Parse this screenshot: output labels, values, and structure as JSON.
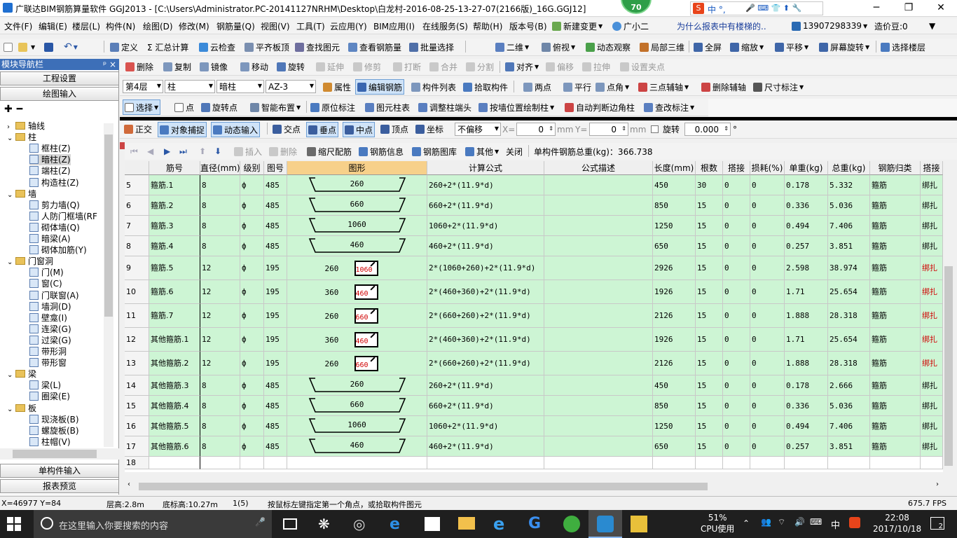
{
  "window": {
    "title": "广联达BIM钢筋算量软件 GGJ2013 - [C:\\Users\\Administrator.PC-20141127NRHM\\Desktop\\白龙村-2016-08-25-13-27-07(2166版)_16G.GGJ12]",
    "badge": "70",
    "ime": "中 °,"
  },
  "menu": {
    "items": [
      "文件(F)",
      "编辑(E)",
      "楼层(L)",
      "构件(N)",
      "绘图(D)",
      "修改(M)",
      "钢筋量(Q)",
      "视图(V)",
      "工具(T)",
      "云应用(Y)",
      "BIM应用(I)",
      "在线服务(S)",
      "帮助(H)",
      "版本号(B)",
      "新建变更",
      "广小二"
    ],
    "question": "为什么报表中有楼梯的..",
    "phone": "13907298339",
    "price": "造价豆:0"
  },
  "toolbar1": [
    "定义",
    "Σ 汇总计算",
    "云检查",
    "平齐板顶",
    "查找图元",
    "查看钢筋量",
    "批量选择",
    "二维",
    "俯视",
    "动态观察",
    "局部三维",
    "全屏",
    "缩放",
    "平移",
    "屏幕旋转",
    "选择楼层"
  ],
  "toolbar2": [
    "删除",
    "复制",
    "镜像",
    "移动",
    "旋转",
    "延伸",
    "修剪",
    "打断",
    "合并",
    "分割",
    "对齐",
    "偏移",
    "拉伸",
    "设置夹点"
  ],
  "toolbar3": {
    "floor": "第4层",
    "type": "柱",
    "subtype": "暗柱",
    "name": "AZ-3",
    "items": [
      "属性",
      "编辑钢筋",
      "构件列表",
      "拾取构件",
      "两点",
      "平行",
      "点角",
      "三点辅轴",
      "删除辅轴",
      "尺寸标注"
    ]
  },
  "toolbar4": [
    "选择",
    "点",
    "旋转点",
    "智能布置",
    "原位标注",
    "图元柱表",
    "调整柱端头",
    "按墙位置绘制柱",
    "自动判断边角柱",
    "查改标注"
  ],
  "snapbar": {
    "items": [
      "正交",
      "对象捕捉",
      "动态输入",
      "交点",
      "垂点",
      "中点",
      "顶点",
      "坐标"
    ],
    "offset": "不偏移",
    "x_label": "X=",
    "x_val": "0",
    "y_label": "Y=",
    "y_val": "0",
    "unit": "mm",
    "rotate": "旋转",
    "rotate_val": "0.000",
    "deg": "°"
  },
  "rebarbar": {
    "items": [
      "插入",
      "删除",
      "缩尺配筋",
      "钢筋信息",
      "钢筋图库",
      "其他",
      "关闭"
    ],
    "total": "单构件钢筋总重(kg)：366.738"
  },
  "panel": {
    "title": "模块导航栏",
    "pin": "ᵖ ×",
    "btn_project": "工程设置",
    "btn_draw": "绘图输入",
    "btn_single": "单构件输入",
    "btn_report": "报表预览"
  },
  "tree": [
    {
      "t": "轴线",
      "lvl": 0,
      "kind": "folder",
      "exp": "›"
    },
    {
      "t": "柱",
      "lvl": 0,
      "kind": "folder",
      "exp": "⌄"
    },
    {
      "t": "框柱(Z)",
      "lvl": 1,
      "kind": "leaf"
    },
    {
      "t": "暗柱(Z)",
      "lvl": 1,
      "kind": "leaf",
      "sel": true
    },
    {
      "t": "端柱(Z)",
      "lvl": 1,
      "kind": "leaf"
    },
    {
      "t": "构造柱(Z)",
      "lvl": 1,
      "kind": "leaf"
    },
    {
      "t": "墙",
      "lvl": 0,
      "kind": "folder",
      "exp": "⌄"
    },
    {
      "t": "剪力墙(Q)",
      "lvl": 1,
      "kind": "leaf"
    },
    {
      "t": "人防门框墙(RF",
      "lvl": 1,
      "kind": "leaf"
    },
    {
      "t": "砌体墙(Q)",
      "lvl": 1,
      "kind": "leaf"
    },
    {
      "t": "暗梁(A)",
      "lvl": 1,
      "kind": "leaf"
    },
    {
      "t": "砌体加筋(Y)",
      "lvl": 1,
      "kind": "leaf"
    },
    {
      "t": "门窗洞",
      "lvl": 0,
      "kind": "folder",
      "exp": "⌄"
    },
    {
      "t": "门(M)",
      "lvl": 1,
      "kind": "leaf"
    },
    {
      "t": "窗(C)",
      "lvl": 1,
      "kind": "leaf"
    },
    {
      "t": "门联窗(A)",
      "lvl": 1,
      "kind": "leaf"
    },
    {
      "t": "墙洞(D)",
      "lvl": 1,
      "kind": "leaf"
    },
    {
      "t": "壁龛(I)",
      "lvl": 1,
      "kind": "leaf"
    },
    {
      "t": "连梁(G)",
      "lvl": 1,
      "kind": "leaf"
    },
    {
      "t": "过梁(G)",
      "lvl": 1,
      "kind": "leaf"
    },
    {
      "t": "带形洞",
      "lvl": 1,
      "kind": "leaf"
    },
    {
      "t": "带形窗",
      "lvl": 1,
      "kind": "leaf"
    },
    {
      "t": "梁",
      "lvl": 0,
      "kind": "folder",
      "exp": "⌄"
    },
    {
      "t": "梁(L)",
      "lvl": 1,
      "kind": "leaf"
    },
    {
      "t": "圈梁(E)",
      "lvl": 1,
      "kind": "leaf"
    },
    {
      "t": "板",
      "lvl": 0,
      "kind": "folder",
      "exp": "⌄"
    },
    {
      "t": "现浇板(B)",
      "lvl": 1,
      "kind": "leaf"
    },
    {
      "t": "螺旋板(B)",
      "lvl": 1,
      "kind": "leaf"
    },
    {
      "t": "柱帽(V)",
      "lvl": 1,
      "kind": "leaf"
    }
  ],
  "table": {
    "headers": [
      "",
      "筋号",
      "直径(mm)",
      "级别",
      "图号",
      "图形",
      "计算公式",
      "公式描述",
      "长度(mm)",
      "根数",
      "搭接",
      "损耗(%)",
      "单重(kg)",
      "总重(kg)",
      "钢筋归类",
      "搭接"
    ],
    "rows": [
      {
        "n": "5",
        "name": "箍筋.1",
        "dia": "8",
        "grade": "ф",
        "fig": "485",
        "shape": "hook",
        "s1": "260",
        "s2": "",
        "formula": "260+2*(11.9*d)",
        "desc": "",
        "len": "450",
        "cnt": "30",
        "lap": "0",
        "loss": "0",
        "uw": "0.178",
        "tw": "5.332",
        "cat": "箍筋",
        "lapt": "绑扎",
        "red": false
      },
      {
        "n": "6",
        "name": "箍筋.2",
        "dia": "8",
        "grade": "ф",
        "fig": "485",
        "shape": "hook",
        "s1": "660",
        "s2": "",
        "formula": "660+2*(11.9*d)",
        "desc": "",
        "len": "850",
        "cnt": "15",
        "lap": "0",
        "loss": "0",
        "uw": "0.336",
        "tw": "5.036",
        "cat": "箍筋",
        "lapt": "绑扎",
        "red": false
      },
      {
        "n": "7",
        "name": "箍筋.3",
        "dia": "8",
        "grade": "ф",
        "fig": "485",
        "shape": "hook",
        "s1": "1060",
        "s2": "",
        "formula": "1060+2*(11.9*d)",
        "desc": "",
        "len": "1250",
        "cnt": "15",
        "lap": "0",
        "loss": "0",
        "uw": "0.494",
        "tw": "7.406",
        "cat": "箍筋",
        "lapt": "绑扎",
        "red": false
      },
      {
        "n": "8",
        "name": "箍筋.4",
        "dia": "8",
        "grade": "ф",
        "fig": "485",
        "shape": "hook",
        "s1": "460",
        "s2": "",
        "formula": "460+2*(11.9*d)",
        "desc": "",
        "len": "650",
        "cnt": "15",
        "lap": "0",
        "loss": "0",
        "uw": "0.257",
        "tw": "3.851",
        "cat": "箍筋",
        "lapt": "绑扎",
        "red": false
      },
      {
        "n": "9",
        "name": "箍筋.5",
        "dia": "12",
        "grade": "ф",
        "fig": "195",
        "shape": "box",
        "s1": "260",
        "s2": "1060",
        "formula": "2*(1060+260)+2*(11.9*d)",
        "desc": "",
        "len": "2926",
        "cnt": "15",
        "lap": "0",
        "loss": "0",
        "uw": "2.598",
        "tw": "38.974",
        "cat": "箍筋",
        "lapt": "绑扎",
        "red": true
      },
      {
        "n": "10",
        "name": "箍筋.6",
        "dia": "12",
        "grade": "ф",
        "fig": "195",
        "shape": "box",
        "s1": "360",
        "s2": "460",
        "formula": "2*(460+360)+2*(11.9*d)",
        "desc": "",
        "len": "1926",
        "cnt": "15",
        "lap": "0",
        "loss": "0",
        "uw": "1.71",
        "tw": "25.654",
        "cat": "箍筋",
        "lapt": "绑扎",
        "red": true
      },
      {
        "n": "11",
        "name": "箍筋.7",
        "dia": "12",
        "grade": "ф",
        "fig": "195",
        "shape": "box",
        "s1": "260",
        "s2": "660",
        "formula": "2*(660+260)+2*(11.9*d)",
        "desc": "",
        "len": "2126",
        "cnt": "15",
        "lap": "0",
        "loss": "0",
        "uw": "1.888",
        "tw": "28.318",
        "cat": "箍筋",
        "lapt": "绑扎",
        "red": true
      },
      {
        "n": "12",
        "name": "其他箍筋.1",
        "dia": "12",
        "grade": "ф",
        "fig": "195",
        "shape": "box",
        "s1": "360",
        "s2": "460",
        "formula": "2*(460+360)+2*(11.9*d)",
        "desc": "",
        "len": "1926",
        "cnt": "15",
        "lap": "0",
        "loss": "0",
        "uw": "1.71",
        "tw": "25.654",
        "cat": "箍筋",
        "lapt": "绑扎",
        "red": true
      },
      {
        "n": "13",
        "name": "其他箍筋.2",
        "dia": "12",
        "grade": "ф",
        "fig": "195",
        "shape": "box",
        "s1": "260",
        "s2": "660",
        "formula": "2*(660+260)+2*(11.9*d)",
        "desc": "",
        "len": "2126",
        "cnt": "15",
        "lap": "0",
        "loss": "0",
        "uw": "1.888",
        "tw": "28.318",
        "cat": "箍筋",
        "lapt": "绑扎",
        "red": true
      },
      {
        "n": "14",
        "name": "其他箍筋.3",
        "dia": "8",
        "grade": "ф",
        "fig": "485",
        "shape": "hook",
        "s1": "260",
        "s2": "",
        "formula": "260+2*(11.9*d)",
        "desc": "",
        "len": "450",
        "cnt": "15",
        "lap": "0",
        "loss": "0",
        "uw": "0.178",
        "tw": "2.666",
        "cat": "箍筋",
        "lapt": "绑扎",
        "red": false
      },
      {
        "n": "15",
        "name": "其他箍筋.4",
        "dia": "8",
        "grade": "ф",
        "fig": "485",
        "shape": "hook",
        "s1": "660",
        "s2": "",
        "formula": "660+2*(11.9*d)",
        "desc": "",
        "len": "850",
        "cnt": "15",
        "lap": "0",
        "loss": "0",
        "uw": "0.336",
        "tw": "5.036",
        "cat": "箍筋",
        "lapt": "绑扎",
        "red": false
      },
      {
        "n": "16",
        "name": "其他箍筋.5",
        "dia": "8",
        "grade": "ф",
        "fig": "485",
        "shape": "hook",
        "s1": "1060",
        "s2": "",
        "formula": "1060+2*(11.9*d)",
        "desc": "",
        "len": "1250",
        "cnt": "15",
        "lap": "0",
        "loss": "0",
        "uw": "0.494",
        "tw": "7.406",
        "cat": "箍筋",
        "lapt": "绑扎",
        "red": false
      },
      {
        "n": "17",
        "name": "其他箍筋.6",
        "dia": "8",
        "grade": "ф",
        "fig": "485",
        "shape": "hook",
        "s1": "460",
        "s2": "",
        "formula": "460+2*(11.9*d)",
        "desc": "",
        "len": "650",
        "cnt": "15",
        "lap": "0",
        "loss": "0",
        "uw": "0.257",
        "tw": "3.851",
        "cat": "箍筋",
        "lapt": "绑扎",
        "red": false
      },
      {
        "n": "18",
        "name": "",
        "dia": "",
        "grade": "",
        "fig": "",
        "shape": "",
        "s1": "",
        "s2": "",
        "formula": "",
        "desc": "",
        "len": "",
        "cnt": "",
        "lap": "",
        "loss": "",
        "uw": "",
        "tw": "",
        "cat": "",
        "lapt": "",
        "red": false
      }
    ]
  },
  "status": {
    "coords": "X=46977 Y=84",
    "floor_h": "层高:2.8m",
    "base_h": "底标高:10.27m",
    "count": "1(5)",
    "hint": "按鼠标左键指定第一个角点，或拾取构件图元",
    "fps": "675.7 FPS"
  },
  "taskbar": {
    "search": "在这里输入你要搜索的内容",
    "cpu_pct": "51%",
    "cpu_label": "CPU使用",
    "time": "22:08",
    "date": "2017/10/18",
    "lang": "中",
    "notif": "2"
  },
  "colors": {
    "row_bg": "#cdf5d4",
    "accent": "#3d6fb8",
    "red": "#d00000"
  }
}
